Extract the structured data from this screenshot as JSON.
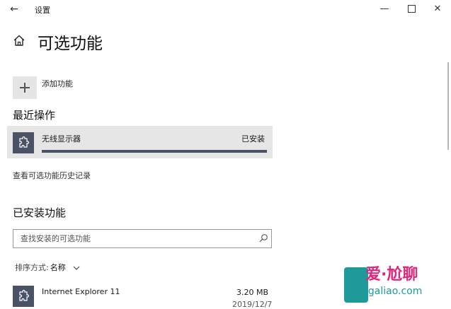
{
  "window": {
    "back_glyph": "←",
    "title": "设置",
    "minimize_glyph": "—",
    "close_glyph": "✕"
  },
  "page": {
    "title": "可选功能",
    "home_icon": "home-icon"
  },
  "add_feature": {
    "label": "添加功能",
    "icon": "plus-icon"
  },
  "recent": {
    "section_title": "最近操作",
    "items": [
      {
        "name": "无线显示器",
        "status": "已安装",
        "progress": 1.0,
        "icon": "puzzle-icon"
      }
    ]
  },
  "history_link": "查看可选功能历史记录",
  "installed": {
    "section_title": "已安装功能",
    "search": {
      "placeholder": "查找安装的可选功能",
      "value": ""
    },
    "sort": {
      "label": "排序方式:",
      "value": "名称"
    },
    "items": [
      {
        "name": "Internet Explorer 11",
        "size": "3.20 MB",
        "date": "2019/12/7",
        "icon": "puzzle-icon"
      }
    ]
  },
  "watermark": {
    "line1": "爱·尬聊",
    "line2": "igaliao.com"
  },
  "colors": {
    "accent": "#4a5266",
    "card_bg": "#e6e6e6"
  }
}
